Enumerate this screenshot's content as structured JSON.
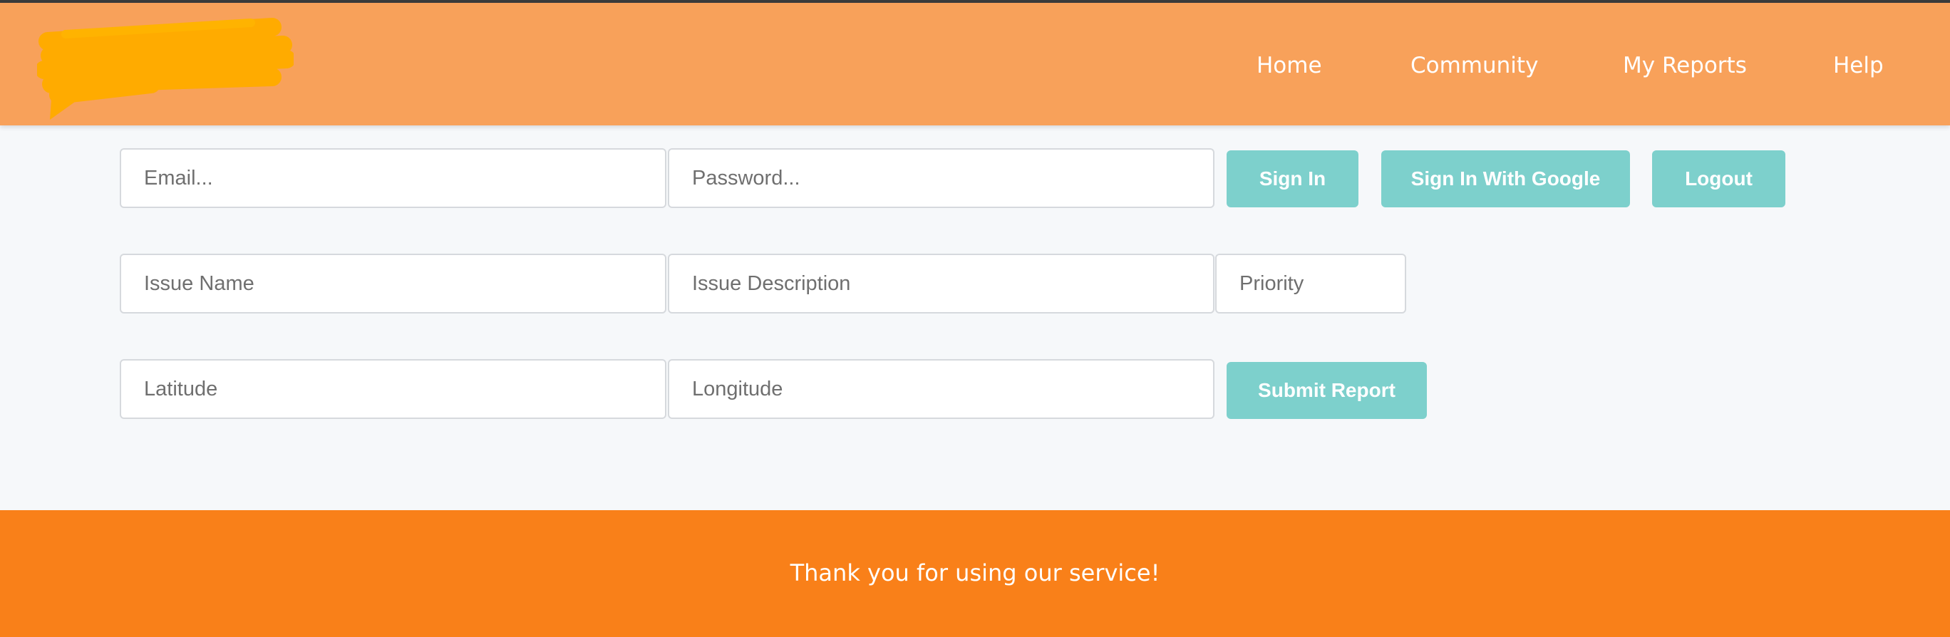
{
  "header": {
    "nav": [
      {
        "label": "Home"
      },
      {
        "label": "Community"
      },
      {
        "label": "My Reports"
      },
      {
        "label": "Help"
      }
    ]
  },
  "auth": {
    "email_placeholder": "Email...",
    "password_placeholder": "Password...",
    "sign_in_label": "Sign In",
    "google_label": "Sign In With Google",
    "logout_label": "Logout"
  },
  "report": {
    "issue_name_placeholder": "Issue Name",
    "issue_description_placeholder": "Issue Description",
    "priority_placeholder": "Priority",
    "latitude_placeholder": "Latitude",
    "longitude_placeholder": "Longitude",
    "submit_label": "Submit Report"
  },
  "footer": {
    "text": "Thank you for using our service!"
  },
  "colors": {
    "header_bg": "#f8a15a",
    "footer_bg": "#f98019",
    "button_bg": "#7dd0cc",
    "logo_scribble": "#ffab00"
  }
}
